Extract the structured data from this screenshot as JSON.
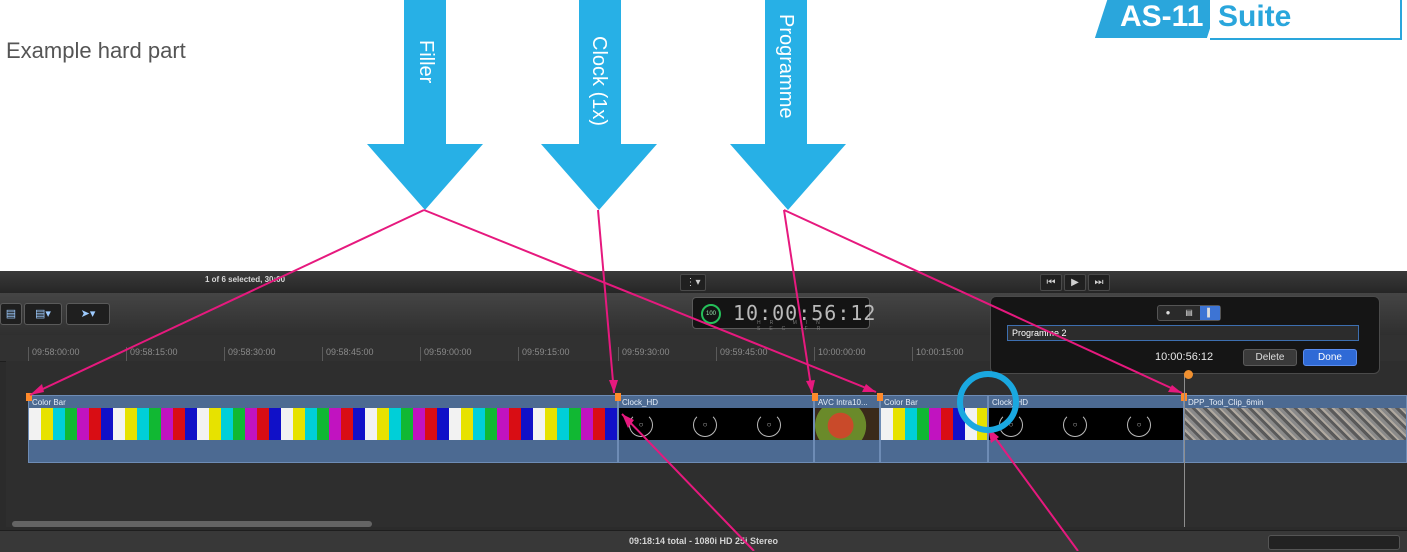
{
  "subtitle": "Example hard part",
  "logo": {
    "part1": "AS-11",
    "part2": "Suite"
  },
  "arrows": [
    {
      "label": "Filler"
    },
    {
      "label": "Clock (1x)"
    },
    {
      "label": "Programme"
    }
  ],
  "toolbar": {
    "selection_info": "1 of 6 selected, 30:00",
    "timecode": "10:00:56:12",
    "timecode_units": "HR MIN SEC FR",
    "speed_badge": "100"
  },
  "ruler": {
    "ticks": [
      "09:58:00:00",
      "09:58:15:00",
      "09:58:30:00",
      "09:58:45:00",
      "09:59:00:00",
      "09:59:15:00",
      "09:59:30:00",
      "09:59:45:00",
      "10:00:00:00",
      "10:00:15:00"
    ]
  },
  "clips": [
    {
      "name": "Color Bar"
    },
    {
      "name": "Clock_HD"
    },
    {
      "name": "AVC Intra10..."
    },
    {
      "name": "Color Bar"
    },
    {
      "name": "Clock_HD"
    },
    {
      "name": "DPP_Tool_Clip_6min"
    }
  ],
  "marker_popup": {
    "name_value": "Programme 2",
    "timecode": "10:00:56:12",
    "delete_label": "Delete",
    "done_label": "Done"
  },
  "footer": {
    "status": "09:18:14 total - 1080i HD 25i Stereo"
  },
  "colors": {
    "arrow": "#27b0e6",
    "annotation_line": "#e6197e",
    "highlight_circle": "#1aa8e0",
    "clip": "#4c6a92"
  }
}
